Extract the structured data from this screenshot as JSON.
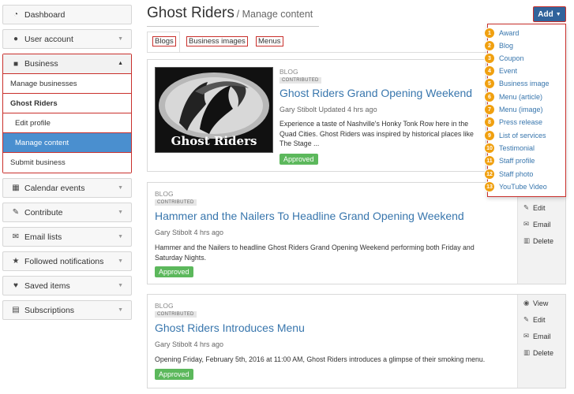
{
  "sidebar": {
    "dashboard": "Dashboard",
    "user_account": "User account",
    "business": "Business",
    "business_sub": {
      "manage_businesses": "Manage businesses",
      "ghost_riders": "Ghost Riders",
      "edit_profile": "Edit profile",
      "manage_content": "Manage content",
      "submit_business": "Submit business"
    },
    "calendar_events": "Calendar events",
    "contribute": "Contribute",
    "email_lists": "Email lists",
    "followed_notifications": "Followed notifications",
    "saved_items": "Saved items",
    "subscriptions": "Subscriptions"
  },
  "header": {
    "title": "Ghost Riders",
    "subtitle": "/ Manage content",
    "add_label": "Add"
  },
  "tabs": {
    "blogs": "Blogs",
    "business_images": "Business images",
    "menus": "Menus"
  },
  "thumb": {
    "caption": "Ghost Riders"
  },
  "posts": [
    {
      "type": "BLOG",
      "badge": "CONTRIBUTED",
      "title": "Ghost Riders Grand Opening Weekend",
      "meta": "Gary Stibolt   Updated 4 hrs ago",
      "excerpt": "Experience a taste of Nashville's Honky Tonk Row here in the Quad Cities.  Ghost Riders was inspired by historical places like The Stage ...",
      "status": "Approved"
    },
    {
      "type": "BLOG",
      "badge": "CONTRIBUTED",
      "title": "Hammer and the Nailers To Headline Grand Opening Weekend",
      "meta": "Gary Stibolt   4 hrs ago",
      "excerpt": "Hammer and the Nailers to headline Ghost Riders Grand Opening Weekend performing both Friday and Saturday Nights.",
      "status": "Approved"
    },
    {
      "type": "BLOG",
      "badge": "CONTRIBUTED",
      "title": "Ghost Riders Introduces Menu",
      "meta": "Gary Stibolt   4 hrs ago",
      "excerpt": "Opening Friday, February 5th, 2016 at 11:00 AM, Ghost Riders introduces a glimpse of their smoking menu.",
      "status": "Approved"
    }
  ],
  "actions": {
    "view": "View",
    "edit": "Edit",
    "email": "Email",
    "delete": "Delete"
  },
  "dropdown": [
    {
      "n": "1",
      "label": "Award"
    },
    {
      "n": "2",
      "label": "Blog"
    },
    {
      "n": "3",
      "label": "Coupon"
    },
    {
      "n": "4",
      "label": "Event"
    },
    {
      "n": "5",
      "label": "Business image"
    },
    {
      "n": "6",
      "label": "Menu (article)"
    },
    {
      "n": "7",
      "label": "Menu (image)"
    },
    {
      "n": "8",
      "label": "Press release"
    },
    {
      "n": "9",
      "label": "List of services"
    },
    {
      "n": "10",
      "label": "Testimonial"
    },
    {
      "n": "11",
      "label": "Staff profile"
    },
    {
      "n": "12",
      "label": "Staff photo"
    },
    {
      "n": "13",
      "label": "YouTube Video"
    }
  ],
  "colors": {
    "accent": "#31639b",
    "highlight": "#c9302c",
    "active": "#4a8fcf",
    "approved": "#5cb85c",
    "badge": "#f0a010"
  }
}
